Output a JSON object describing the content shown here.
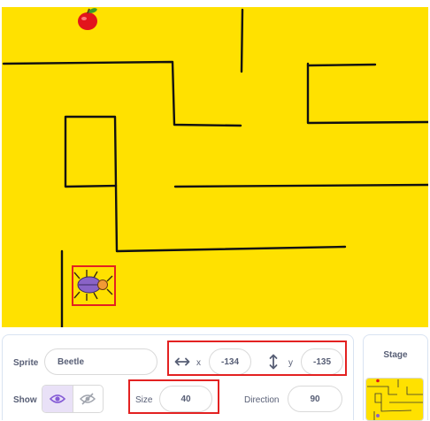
{
  "sprite_info": {
    "sprite_label": "Sprite",
    "sprite_name": "Beetle",
    "x_label": "x",
    "x_value": "-134",
    "y_label": "y",
    "y_value": "-135",
    "show_label": "Show",
    "size_label": "Size",
    "size_value": "40",
    "direction_label": "Direction",
    "direction_value": "90"
  },
  "stage_panel": {
    "title": "Stage"
  },
  "colors": {
    "maze_background": "#ffe100",
    "highlight": "#e32121",
    "active_eye": "#855cd6",
    "text": "#575e75"
  },
  "icons": [
    "apple-icon",
    "beetle-icon",
    "x-arrows-icon",
    "y-arrows-icon",
    "eye-icon",
    "eye-slash-icon"
  ]
}
